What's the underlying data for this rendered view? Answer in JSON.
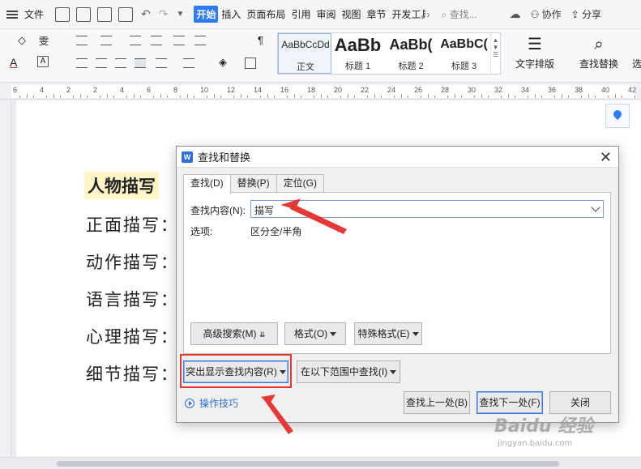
{
  "menubar": {
    "file_label": "文件",
    "tabs": [
      "开始",
      "插入",
      "页面布局",
      "引用",
      "审阅",
      "视图",
      "章节",
      "开发工具"
    ],
    "active_tab": "开始",
    "search_placeholder": "查找...",
    "collaborate": "协作",
    "share": "分享"
  },
  "ribbon": {
    "styles": [
      {
        "preview": "AaBbCcDd",
        "name": "正文"
      },
      {
        "preview": "AaBb",
        "name": "标题 1"
      },
      {
        "preview": "AaBb(",
        "name": "标题 2"
      },
      {
        "preview": "AaBbC(",
        "name": "标题 3"
      }
    ],
    "text_layout": "文字排版",
    "find_replace": "查找替换",
    "more": "选"
  },
  "ruler": {
    "numbers": [
      "6",
      "4",
      "2",
      "2",
      "4",
      "6",
      "8",
      "10",
      "12",
      "14",
      "16",
      "18",
      "20",
      "22",
      "24",
      "26",
      "28",
      "30",
      "32",
      "34",
      "36",
      "38",
      "40",
      "42"
    ]
  },
  "document": {
    "title": "人物描写",
    "lines": [
      "正面描写：",
      "动作描写：",
      "语言描写：",
      "心理描写：",
      "细节描写："
    ]
  },
  "dialog": {
    "title": "查找和替换",
    "tabs": [
      "查找(D)",
      "替换(P)",
      "定位(G)"
    ],
    "find_label": "查找内容(N):",
    "find_value": "描写",
    "options_label": "选项:",
    "options_value": "区分全/半角",
    "btn_advanced": "高级搜索(M)",
    "btn_format": "格式(O)",
    "btn_special": "特殊格式(E)",
    "btn_highlight": "突出显示查找内容(R)",
    "btn_scope": "在以下范围中查找(I)",
    "tips": "操作技巧",
    "btn_prev": "查找上一处(B)",
    "btn_next": "查找下一处(F)",
    "btn_close": "关闭"
  },
  "watermark": {
    "text": "Baidu 经验",
    "url": "jingyan.baidu.com"
  },
  "colors": {
    "accent": "#2f7cf6",
    "annotation": "#e53935",
    "highlight": "#fff5c7"
  }
}
